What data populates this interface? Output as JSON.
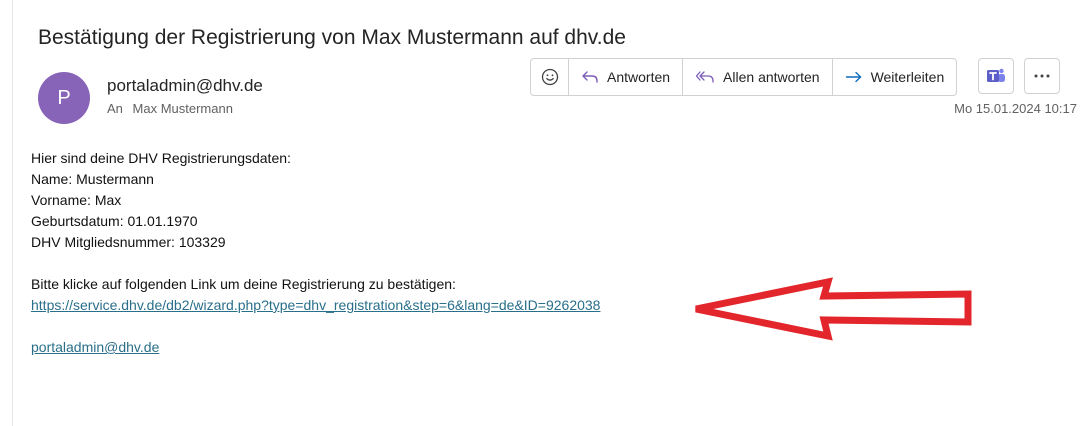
{
  "email": {
    "subject": "Bestätigung der Registrierung von Max Mustermann auf dhv.de",
    "sender": {
      "avatar_initial": "P",
      "avatar_color": "#8764b8",
      "address": "portaladmin@dhv.de"
    },
    "to_label": "An",
    "to_name": "Max Mustermann",
    "date": "Mo 15.01.2024 10:17"
  },
  "actions": {
    "emoji_icon": "smiley-icon",
    "reply_label": "Antworten",
    "reply_all_label": "Allen antworten",
    "forward_label": "Weiterleiten",
    "teams_icon": "teams-icon",
    "more_icon": "more-icon"
  },
  "body": {
    "intro": "Hier sind deine DHV Registrierungsdaten:",
    "name_line": "Name: Mustermann",
    "first_name_line": "Vorname: Max",
    "birthdate_line": "Geburtsdatum: 01.01.1970",
    "member_line": "DHV Mitgliedsnummer: 103329",
    "instruction": "Bitte klicke auf folgenden Link um deine Registrierung zu bestätigen:",
    "link": "https://service.dhv.de/db2/wizard.php?type=dhv_registration&step=6&lang=de&ID=9262038",
    "signature_link": "portaladmin@dhv.de"
  },
  "colors": {
    "accent": "#2a6f8a",
    "arrow": "#e3262b",
    "teams": "#5b5fc7"
  }
}
